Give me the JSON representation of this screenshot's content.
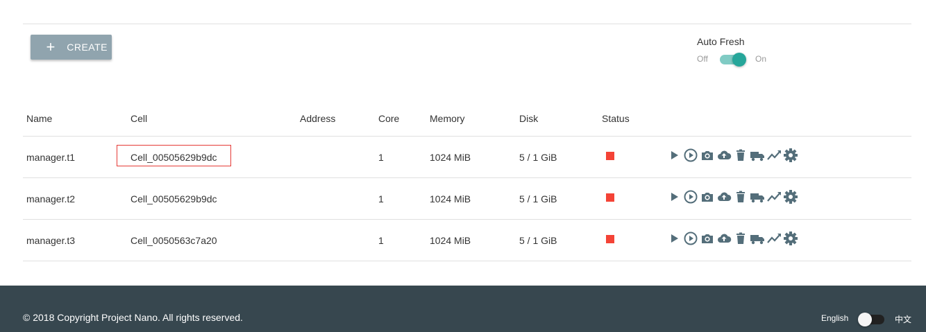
{
  "toolbar": {
    "create_label": "CREATE",
    "create_icon": "plus-icon"
  },
  "auto_fresh": {
    "title": "Auto Fresh",
    "off_label": "Off",
    "on_label": "On",
    "enabled": true,
    "accent": "#26a69a"
  },
  "table": {
    "headers": [
      "Name",
      "Cell",
      "Address",
      "Core",
      "Memory",
      "Disk",
      "Status"
    ],
    "rows": [
      {
        "name": "manager.t1",
        "cell": "Cell_00505629b9dc",
        "address": "",
        "core": "1",
        "memory": "1024 MiB",
        "disk": "5 / 1 GiB",
        "status": "stopped"
      },
      {
        "name": "manager.t2",
        "cell": "Cell_00505629b9dc",
        "address": "",
        "core": "1",
        "memory": "1024 MiB",
        "disk": "5 / 1 GiB",
        "status": "stopped"
      },
      {
        "name": "manager.t3",
        "cell": "Cell_0050563c7a20",
        "address": "",
        "core": "1",
        "memory": "1024 MiB",
        "disk": "5 / 1 GiB",
        "status": "stopped"
      }
    ],
    "status_color": "#f44336",
    "row_actions": [
      "play-icon",
      "play-circle-icon",
      "camera-icon",
      "cloud-upload-icon",
      "trash-icon",
      "truck-icon",
      "trending-icon",
      "gear-icon"
    ]
  },
  "footer": {
    "copyright": "© 2018 Copyright Project Nano. All rights reserved.",
    "lang_en": "English",
    "lang_zh": "中文",
    "bg": "#37474f"
  }
}
